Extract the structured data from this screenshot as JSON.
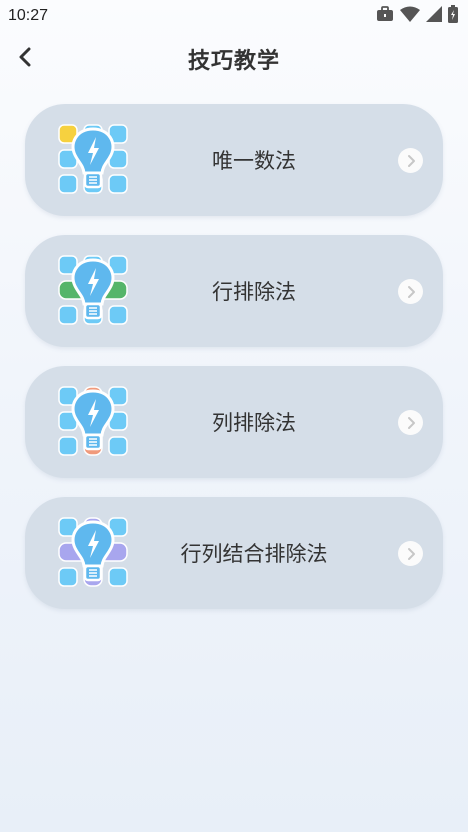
{
  "status_bar": {
    "time": "10:27"
  },
  "header": {
    "title": "技巧教学"
  },
  "colors": {
    "tile": "#6dcaf6",
    "bulb": "#5fb8ee",
    "card_bg": "#d5dee8"
  },
  "cards": [
    {
      "label": "唯一数法",
      "accent": "#f6d13f",
      "accent_name": "yellow-tile"
    },
    {
      "label": "行排除法",
      "accent": "#55b56a",
      "accent_name": "green-row"
    },
    {
      "label": "列排除法",
      "accent": "#f09a7c",
      "accent_name": "orange-column"
    },
    {
      "label": "行列结合排除法",
      "accent": "#a8a6ee",
      "accent_name": "purple-row-column"
    }
  ]
}
